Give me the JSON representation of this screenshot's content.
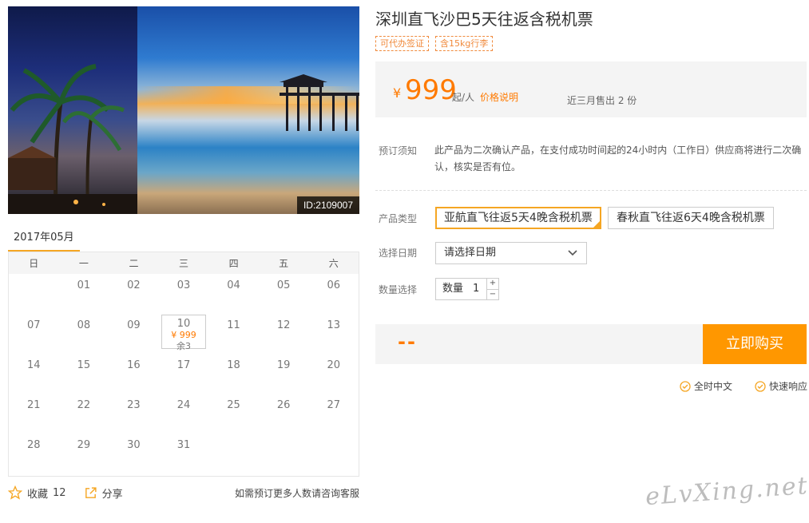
{
  "product": {
    "title": "深圳直飞沙巴5天往返含税机票",
    "tags": [
      "可代办签证",
      "含15kg行李"
    ],
    "image_id": "ID:2109007"
  },
  "price": {
    "currency": "¥",
    "amount": "999",
    "unit": "起/人",
    "link": "价格说明",
    "sold": "近三月售出 2 份"
  },
  "booking": {
    "notice_label": "预订须知",
    "notice_text": "此产品为二次确认产品，在支付成功时间起的24小时内（工作日）供应商将进行二次确认，核实是否有位。",
    "type_label": "产品类型",
    "types": [
      "亚航直飞往返5天4晚含税机票",
      "春秋直飞往返6天4晚含税机票"
    ],
    "selected_type_index": 0,
    "date_label": "选择日期",
    "date_placeholder": "请选择日期",
    "qty_label": "数量选择",
    "qty_field_label": "数量",
    "qty_value": "1",
    "qty_plus": "+",
    "qty_minus": "−"
  },
  "buy": {
    "total": "--",
    "button": "立即购买"
  },
  "services": [
    "全时中文",
    "快速响应"
  ],
  "calendar": {
    "month": "2017年05月",
    "weekdays": [
      "日",
      "一",
      "二",
      "三",
      "四",
      "五",
      "六"
    ],
    "weeks": [
      [
        "",
        "01",
        "02",
        "03",
        "04",
        "05",
        "06"
      ],
      [
        "07",
        "08",
        "09",
        "10",
        "11",
        "12",
        "13"
      ],
      [
        "14",
        "15",
        "16",
        "17",
        "18",
        "19",
        "20"
      ],
      [
        "21",
        "22",
        "23",
        "24",
        "25",
        "26",
        "27"
      ],
      [
        "28",
        "29",
        "30",
        "31",
        "",
        "",
        ""
      ]
    ],
    "available": {
      "day": "10",
      "price": "¥ 999",
      "remain": "余3"
    }
  },
  "social": {
    "favorite": "收藏",
    "favorite_count": "12",
    "share": "分享",
    "consult": "如需预订更多人数请咨询客服"
  },
  "watermark": "eLvXing.net",
  "colors": {
    "accent": "#ff7a00",
    "button": "#ff9700",
    "selected_border": "#f5a623"
  }
}
